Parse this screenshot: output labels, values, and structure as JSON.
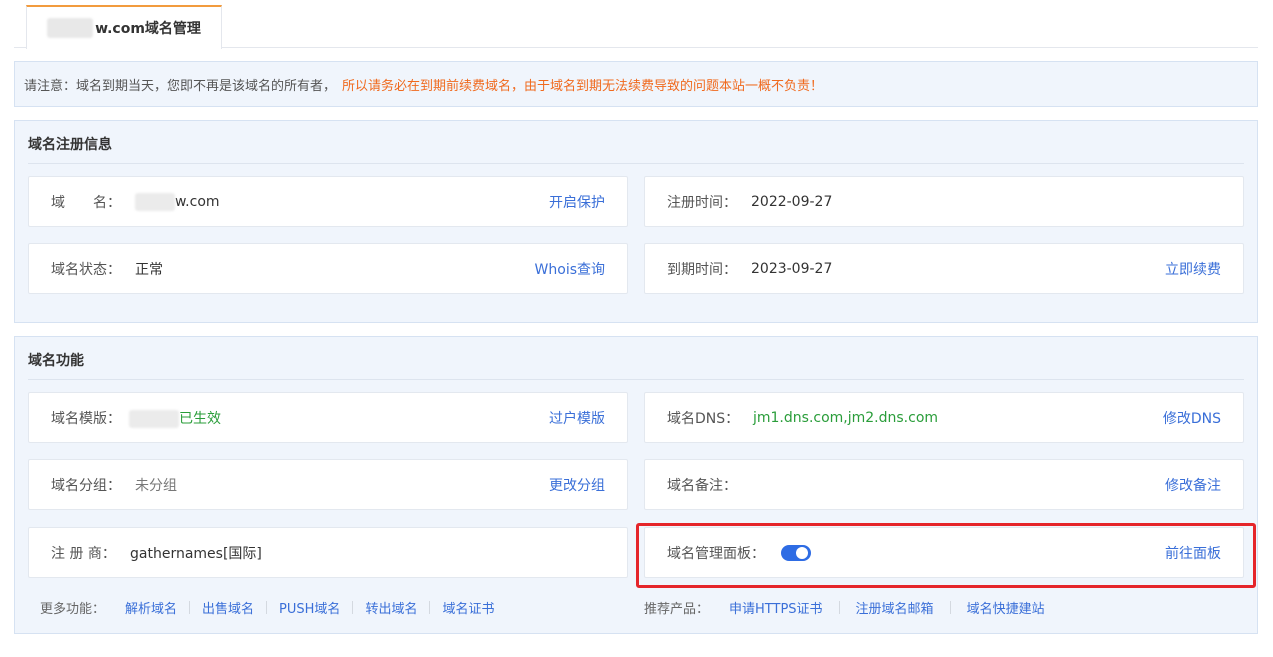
{
  "tab": {
    "label_suffix": "w.com域名管理"
  },
  "notice": {
    "text": "请注意：域名到期当天，您即不再是该域名的所有者，",
    "warning": "所以请务必在到期前续费域名，由于域名到期无法续费导致的问题本站一概不负责！"
  },
  "registration": {
    "title": "域名注册信息",
    "domain_label": "域　　名：",
    "domain_value": "w.com",
    "domain_action": "开启保护",
    "reg_time_label": "注册时间：",
    "reg_time_value": "2022-09-27",
    "status_label": "域名状态：",
    "status_value": "正常",
    "status_action": "Whois查询",
    "expire_label": "到期时间：",
    "expire_value": "2023-09-27",
    "expire_action": "立即续费"
  },
  "features": {
    "title": "域名功能",
    "template_label": "域名模版：",
    "template_value": "已生效",
    "template_action": "过户模版",
    "dns_label": "域名DNS：",
    "dns_value": "jm1.dns.com,jm2.dns.com",
    "dns_action": "修改DNS",
    "group_label": "域名分组：",
    "group_value": "未分组",
    "group_action": "更改分组",
    "remark_label": "域名备注：",
    "remark_action": "修改备注",
    "registrar_label": "注 册 商：",
    "registrar_value": "gathernames[国际]",
    "panel_label": "域名管理面板：",
    "panel_toggle_on": true,
    "panel_action": "前往面板"
  },
  "more": {
    "label": "更多功能：",
    "links": [
      "解析域名",
      "出售域名",
      "PUSH域名",
      "转出域名",
      "域名证书"
    ]
  },
  "recommend": {
    "label": "推荐产品：",
    "links": [
      "申请HTTPS证书",
      "注册域名邮箱",
      "域名快捷建站"
    ]
  },
  "colors": {
    "link": "#3a6fd8",
    "warning": "#f06a1e",
    "success": "#2a9d3a",
    "toggle": "#2e6ce4",
    "highlight": "#e5252a"
  }
}
